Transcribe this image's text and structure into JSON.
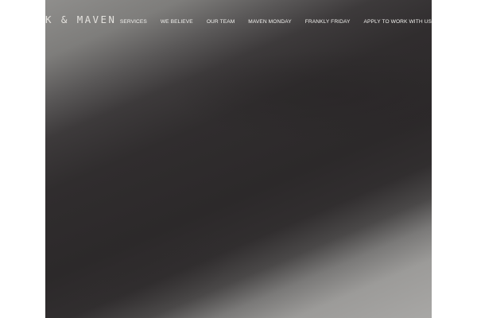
{
  "header": {
    "logo_text": "K & MAVEN"
  },
  "nav": {
    "items": [
      {
        "label": "SERVICES"
      },
      {
        "label": "WE BELIEVE"
      },
      {
        "label": "OUR TEAM"
      },
      {
        "label": "MAVEN MONDAY"
      },
      {
        "label": "FRANKLY FRIDAY"
      },
      {
        "label": "APPLY TO WORK WITH US"
      }
    ]
  },
  "colors": {
    "nav_text": "#f3f2ef",
    "logo_text": "#e4e2de",
    "hero_dark": "#2c292a",
    "hero_light": "#a8a7a5"
  }
}
